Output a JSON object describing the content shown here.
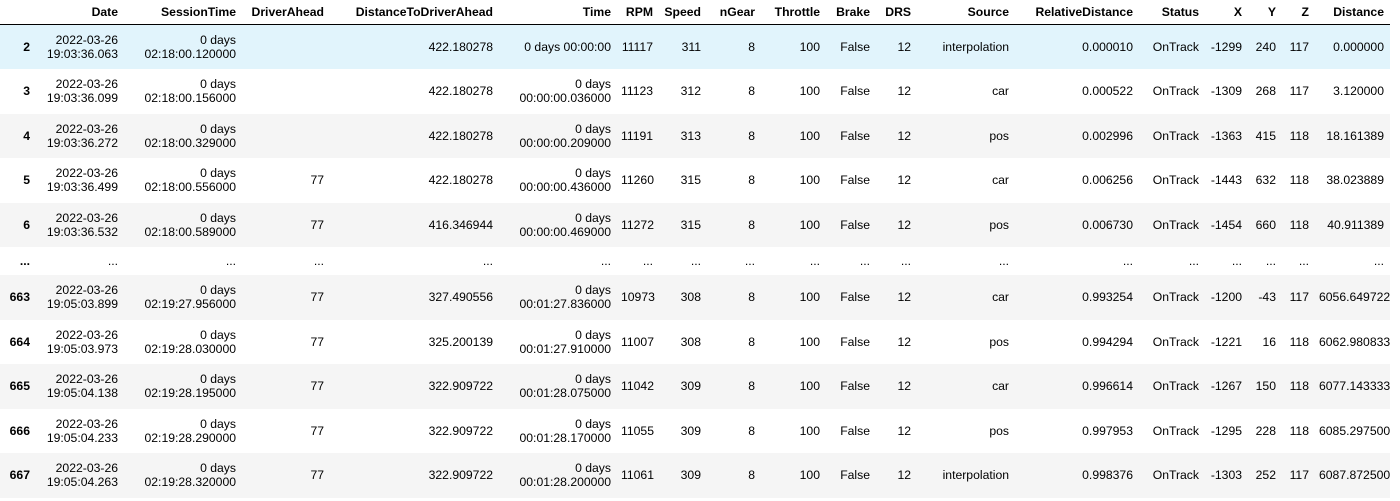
{
  "columns": [
    "",
    "Date",
    "SessionTime",
    "DriverAhead",
    "DistanceToDriverAhead",
    "Time",
    "RPM",
    "Speed",
    "nGear",
    "Throttle",
    "Brake",
    "DRS",
    "Source",
    "RelativeDistance",
    "Status",
    "X",
    "Y",
    "Z",
    "Distance"
  ],
  "rows": [
    {
      "index": "2",
      "date": [
        "2022-03-26",
        "19:03:36.063"
      ],
      "session_time": [
        "0 days",
        "02:18:00.120000"
      ],
      "driver_ahead": "",
      "distance_to_driver_ahead": "422.180278",
      "time": [
        "0 days 00:00:00"
      ],
      "rpm": "11117",
      "speed": "311",
      "ngear": "8",
      "throttle": "100",
      "brake": "False",
      "drs": "12",
      "source": "interpolation",
      "relative_distance": "0.000010",
      "status": "OnTrack",
      "x": "-1299",
      "y": "240",
      "z": "117",
      "distance": "0.000000"
    },
    {
      "index": "3",
      "date": [
        "2022-03-26",
        "19:03:36.099"
      ],
      "session_time": [
        "0 days",
        "02:18:00.156000"
      ],
      "driver_ahead": "",
      "distance_to_driver_ahead": "422.180278",
      "time": [
        "0 days",
        "00:00:00.036000"
      ],
      "rpm": "11123",
      "speed": "312",
      "ngear": "8",
      "throttle": "100",
      "brake": "False",
      "drs": "12",
      "source": "car",
      "relative_distance": "0.000522",
      "status": "OnTrack",
      "x": "-1309",
      "y": "268",
      "z": "117",
      "distance": "3.120000"
    },
    {
      "index": "4",
      "date": [
        "2022-03-26",
        "19:03:36.272"
      ],
      "session_time": [
        "0 days",
        "02:18:00.329000"
      ],
      "driver_ahead": "",
      "distance_to_driver_ahead": "422.180278",
      "time": [
        "0 days",
        "00:00:00.209000"
      ],
      "rpm": "11191",
      "speed": "313",
      "ngear": "8",
      "throttle": "100",
      "brake": "False",
      "drs": "12",
      "source": "pos",
      "relative_distance": "0.002996",
      "status": "OnTrack",
      "x": "-1363",
      "y": "415",
      "z": "118",
      "distance": "18.161389"
    },
    {
      "index": "5",
      "date": [
        "2022-03-26",
        "19:03:36.499"
      ],
      "session_time": [
        "0 days",
        "02:18:00.556000"
      ],
      "driver_ahead": "77",
      "distance_to_driver_ahead": "422.180278",
      "time": [
        "0 days",
        "00:00:00.436000"
      ],
      "rpm": "11260",
      "speed": "315",
      "ngear": "8",
      "throttle": "100",
      "brake": "False",
      "drs": "12",
      "source": "car",
      "relative_distance": "0.006256",
      "status": "OnTrack",
      "x": "-1443",
      "y": "632",
      "z": "118",
      "distance": "38.023889"
    },
    {
      "index": "6",
      "date": [
        "2022-03-26",
        "19:03:36.532"
      ],
      "session_time": [
        "0 days",
        "02:18:00.589000"
      ],
      "driver_ahead": "77",
      "distance_to_driver_ahead": "416.346944",
      "time": [
        "0 days",
        "00:00:00.469000"
      ],
      "rpm": "11272",
      "speed": "315",
      "ngear": "8",
      "throttle": "100",
      "brake": "False",
      "drs": "12",
      "source": "pos",
      "relative_distance": "0.006730",
      "status": "OnTrack",
      "x": "-1454",
      "y": "660",
      "z": "118",
      "distance": "40.911389"
    },
    {
      "index": "...",
      "date": [
        "..."
      ],
      "session_time": [
        "..."
      ],
      "driver_ahead": "...",
      "distance_to_driver_ahead": "...",
      "time": [
        "..."
      ],
      "rpm": "...",
      "speed": "...",
      "ngear": "...",
      "throttle": "...",
      "brake": "...",
      "drs": "...",
      "source": "...",
      "relative_distance": "...",
      "status": "...",
      "x": "...",
      "y": "...",
      "z": "...",
      "distance": "..."
    },
    {
      "index": "663",
      "date": [
        "2022-03-26",
        "19:05:03.899"
      ],
      "session_time": [
        "0 days",
        "02:19:27.956000"
      ],
      "driver_ahead": "77",
      "distance_to_driver_ahead": "327.490556",
      "time": [
        "0 days",
        "00:01:27.836000"
      ],
      "rpm": "10973",
      "speed": "308",
      "ngear": "8",
      "throttle": "100",
      "brake": "False",
      "drs": "12",
      "source": "car",
      "relative_distance": "0.993254",
      "status": "OnTrack",
      "x": "-1200",
      "y": "-43",
      "z": "117",
      "distance": "6056.649722"
    },
    {
      "index": "664",
      "date": [
        "2022-03-26",
        "19:05:03.973"
      ],
      "session_time": [
        "0 days",
        "02:19:28.030000"
      ],
      "driver_ahead": "77",
      "distance_to_driver_ahead": "325.200139",
      "time": [
        "0 days",
        "00:01:27.910000"
      ],
      "rpm": "11007",
      "speed": "308",
      "ngear": "8",
      "throttle": "100",
      "brake": "False",
      "drs": "12",
      "source": "pos",
      "relative_distance": "0.994294",
      "status": "OnTrack",
      "x": "-1221",
      "y": "16",
      "z": "118",
      "distance": "6062.980833"
    },
    {
      "index": "665",
      "date": [
        "2022-03-26",
        "19:05:04.138"
      ],
      "session_time": [
        "0 days",
        "02:19:28.195000"
      ],
      "driver_ahead": "77",
      "distance_to_driver_ahead": "322.909722",
      "time": [
        "0 days",
        "00:01:28.075000"
      ],
      "rpm": "11042",
      "speed": "309",
      "ngear": "8",
      "throttle": "100",
      "brake": "False",
      "drs": "12",
      "source": "car",
      "relative_distance": "0.996614",
      "status": "OnTrack",
      "x": "-1267",
      "y": "150",
      "z": "118",
      "distance": "6077.143333"
    },
    {
      "index": "666",
      "date": [
        "2022-03-26",
        "19:05:04.233"
      ],
      "session_time": [
        "0 days",
        "02:19:28.290000"
      ],
      "driver_ahead": "77",
      "distance_to_driver_ahead": "322.909722",
      "time": [
        "0 days",
        "00:01:28.170000"
      ],
      "rpm": "11055",
      "speed": "309",
      "ngear": "8",
      "throttle": "100",
      "brake": "False",
      "drs": "12",
      "source": "pos",
      "relative_distance": "0.997953",
      "status": "OnTrack",
      "x": "-1295",
      "y": "228",
      "z": "118",
      "distance": "6085.297500"
    },
    {
      "index": "667",
      "date": [
        "2022-03-26",
        "19:05:04.263"
      ],
      "session_time": [
        "0 days",
        "02:19:28.320000"
      ],
      "driver_ahead": "77",
      "distance_to_driver_ahead": "322.909722",
      "time": [
        "0 days",
        "00:01:28.200000"
      ],
      "rpm": "11061",
      "speed": "309",
      "ngear": "8",
      "throttle": "100",
      "brake": "False",
      "drs": "12",
      "source": "interpolation",
      "relative_distance": "0.998376",
      "status": "OnTrack",
      "x": "-1303",
      "y": "252",
      "z": "117",
      "distance": "6087.872500"
    }
  ]
}
